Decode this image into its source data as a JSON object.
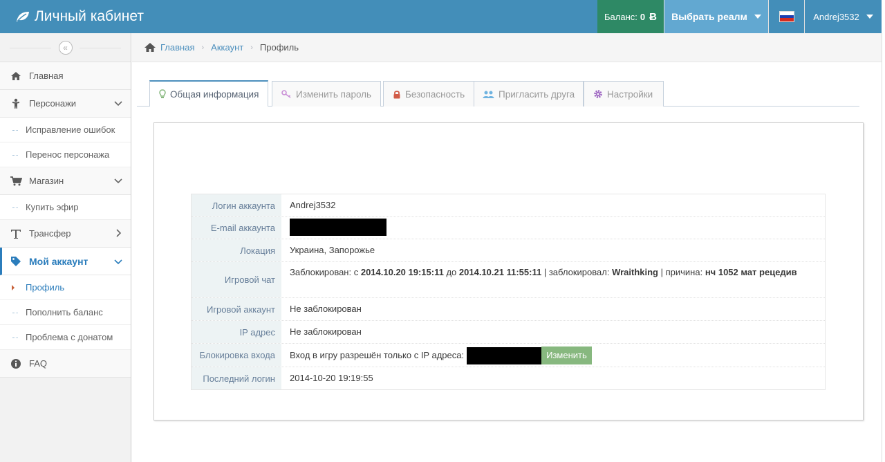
{
  "navbar": {
    "brand": "Личный кабинет",
    "balance_label": "Баланс:",
    "balance_value": "0",
    "currency_symbol": "Ƀ",
    "realm_label": "Выбрать реалм",
    "username": "Andrej3532"
  },
  "sidebar": {
    "collapse_symbol": "«",
    "items": {
      "home": "Главная",
      "characters": "Персонажи",
      "fix_errors": "Исправление ошибок",
      "transfer_char": "Перенос персонажа",
      "shop": "Магазин",
      "buy_ether": "Купить эфир",
      "transfer": "Трансфер",
      "my_account": "Мой аккаунт",
      "profile": "Профиль",
      "top_up": "Пополнить баланс",
      "donate_problem": "Проблема с донатом",
      "faq": "FAQ"
    }
  },
  "breadcrumb": {
    "home": "Главная",
    "account": "Аккаунт",
    "current": "Профиль"
  },
  "tabs": {
    "general": "Общая информация",
    "change_password": "Изменить пароль",
    "security": "Безопасность",
    "invite": "Пригласить друга",
    "settings": "Настройки"
  },
  "profile": {
    "login_label": "Логин аккаунта",
    "login_value": "Andrej3532",
    "email_label": "E-mail аккаунта",
    "location_label": "Локация",
    "location_value": "Украина, Запорожье",
    "chat_label": "Игровой чат",
    "chat_blocked_prefix": "Заблокирован: с",
    "chat_from": "2014.10.20 19:15:11",
    "chat_to_word": "до",
    "chat_to": "2014.10.21 11:55:11",
    "chat_by_label": "| заблокировал:",
    "chat_by": "Wraithking",
    "chat_reason_label": "| причина:",
    "chat_reason": "нч 1052 мат рецедив",
    "game_account_label": "Игровой аккаунт",
    "game_account_value": "Не заблокирован",
    "ip_label": "IP адрес",
    "ip_value": "Не заблокирован",
    "login_lock_label": "Блокировка входа",
    "login_lock_text": "Вход в игру разрешён только с IP адреса:",
    "change_button": "Изменить",
    "last_login_label": "Последний логин",
    "last_login_value": "2014-10-20 19:19:55"
  },
  "colors": {
    "navbar": "#438eb9",
    "balance": "#2e8965",
    "realm": "#62a8d1",
    "accent": "#2b7dbc",
    "button_green": "#87b87f"
  }
}
